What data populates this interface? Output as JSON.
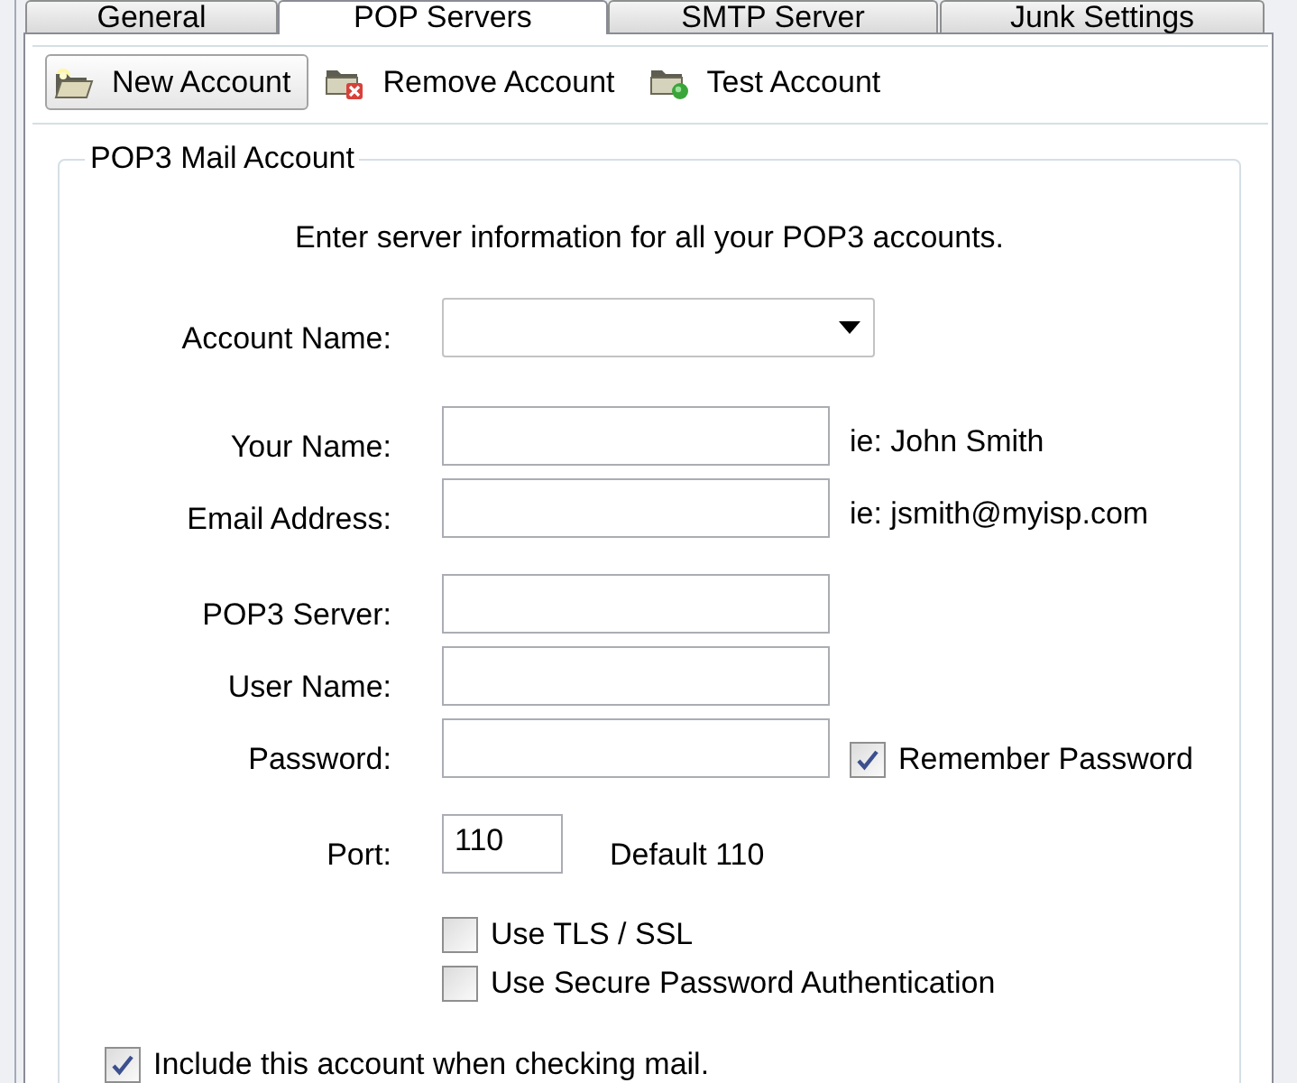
{
  "tabs": [
    {
      "label": "General",
      "selected": false
    },
    {
      "label": "POP Servers",
      "selected": true
    },
    {
      "label": "SMTP Server",
      "selected": false
    },
    {
      "label": "Junk Settings",
      "selected": false
    }
  ],
  "toolbar": {
    "buttons": [
      {
        "label": "New Account",
        "kind": "new",
        "highlighted": true
      },
      {
        "label": "Remove Account",
        "kind": "remove",
        "highlighted": false
      },
      {
        "label": "Test Account",
        "kind": "test",
        "highlighted": false
      }
    ]
  },
  "account_group": {
    "title": "POP3 Mail Account",
    "intro": "Enter server information for all your POP3 accounts.",
    "account_name": {
      "label": "Account Name:"
    },
    "identity_fields": [
      {
        "label": "Your Name:",
        "hint": "ie: John Smith"
      },
      {
        "label": "Email Address:",
        "hint": "ie: jsmith@myisp.com"
      }
    ],
    "server_fields": [
      {
        "label": "POP3 Server:"
      },
      {
        "label": "User Name:"
      },
      {
        "label": "Password:",
        "option": {
          "label": "Remember Password",
          "checked": true
        }
      }
    ],
    "port": {
      "label": "Port:",
      "value": "110",
      "note": "Default 110"
    },
    "security_options": [
      {
        "label": "Use TLS / SSL",
        "checked": false
      },
      {
        "label": "Use Secure Password Authentication",
        "checked": false
      }
    ],
    "include_option": {
      "label": "Include this account when checking mail.",
      "checked": true
    }
  }
}
